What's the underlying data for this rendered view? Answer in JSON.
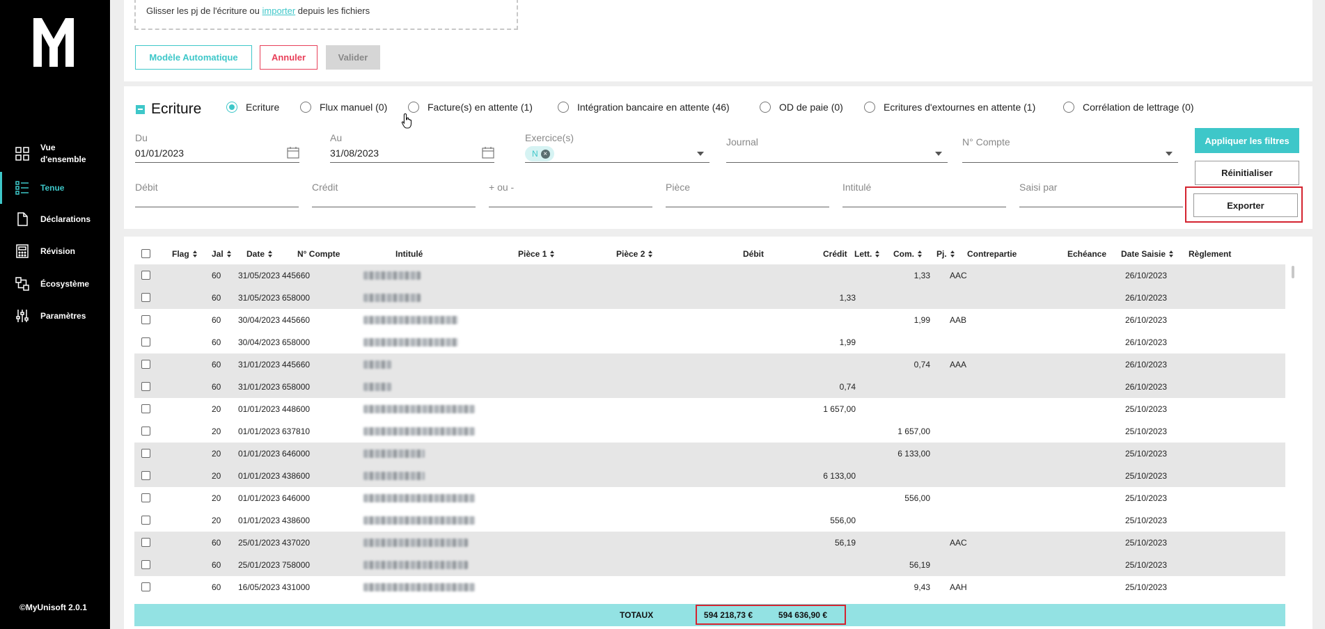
{
  "sidebar": {
    "items": [
      {
        "label": "Vue d'ensemble",
        "icon": "grid-icon"
      },
      {
        "label": "Tenue",
        "icon": "list-icon",
        "active": true
      },
      {
        "label": "Déclarations",
        "icon": "document-icon"
      },
      {
        "label": "Révision",
        "icon": "calculator-icon"
      },
      {
        "label": "Écosystème",
        "icon": "ecosystem-icon"
      },
      {
        "label": "Paramètres",
        "icon": "sliders-icon"
      }
    ],
    "version": "©MyUnisoft 2.0.1"
  },
  "upload": {
    "text_before": "Glisser les pj de l'écriture ou ",
    "link": "importer",
    "text_after": " depuis les fichiers"
  },
  "actions": {
    "modele": "Modèle Automatique",
    "annuler": "Annuler",
    "valider": "Valider"
  },
  "filters": {
    "title": "Ecriture",
    "radios": [
      {
        "label": "Ecriture",
        "checked": true
      },
      {
        "label": "Flux manuel (0)"
      },
      {
        "label": "Facture(s) en attente (1)"
      },
      {
        "label": "Intégration bancaire en attente (46)"
      },
      {
        "label": "OD de paie (0)"
      },
      {
        "label": "Ecritures d'extournes en attente (1)"
      },
      {
        "label": "Corrélation de lettrage (0)"
      }
    ],
    "du_label": "Du",
    "du_value": "01/01/2023",
    "au_label": "Au",
    "au_value": "31/08/2023",
    "exercice_label": "Exercice(s)",
    "exercice_chip": "N",
    "journal_label": "Journal",
    "compte_label": "N° Compte",
    "debit_label": "Débit",
    "credit_label": "Crédit",
    "plusmoins_label": "+ ou -",
    "piece_label": "Pièce",
    "intitule_label": "Intitulé",
    "saisi_label": "Saisi par",
    "apply": "Appliquer les filtres",
    "reset": "Réinitialiser",
    "export": "Exporter"
  },
  "table": {
    "headers": {
      "flag": "Flag",
      "jal": "Jal",
      "date": "Date",
      "compte": "N° Compte",
      "intitule": "Intitulé",
      "piece1": "Pièce 1",
      "piece2": "Pièce 2",
      "debit": "Débit",
      "credit": "Crédit",
      "lett": "Lett.",
      "com": "Com.",
      "pj": "Pj.",
      "contrepartie": "Contrepartie",
      "echeance": "Echéance",
      "date_saisie": "Date Saisie",
      "reglement": "Règlement"
    },
    "rows": [
      {
        "jal": "60",
        "date": "31/05/2023",
        "compte": "445660",
        "debit": "",
        "credit": "1,33",
        "lett": "AAC",
        "date_saisie": "26/10/2023"
      },
      {
        "jal": "60",
        "date": "31/05/2023",
        "compte": "658000",
        "debit": "1,33",
        "credit": "",
        "lett": "",
        "date_saisie": "26/10/2023"
      },
      {
        "jal": "60",
        "date": "30/04/2023",
        "compte": "445660",
        "debit": "",
        "credit": "1,99",
        "lett": "AAB",
        "date_saisie": "26/10/2023"
      },
      {
        "jal": "60",
        "date": "30/04/2023",
        "compte": "658000",
        "debit": "1,99",
        "credit": "",
        "lett": "",
        "date_saisie": "26/10/2023"
      },
      {
        "jal": "60",
        "date": "31/01/2023",
        "compte": "445660",
        "debit": "",
        "credit": "0,74",
        "lett": "AAA",
        "date_saisie": "26/10/2023"
      },
      {
        "jal": "60",
        "date": "31/01/2023",
        "compte": "658000",
        "debit": "0,74",
        "credit": "",
        "lett": "",
        "date_saisie": "26/10/2023"
      },
      {
        "jal": "20",
        "date": "01/01/2023",
        "compte": "448600",
        "debit": "1 657,00",
        "credit": "",
        "lett": "",
        "date_saisie": "25/10/2023"
      },
      {
        "jal": "20",
        "date": "01/01/2023",
        "compte": "637810",
        "debit": "",
        "credit": "1 657,00",
        "lett": "",
        "date_saisie": "25/10/2023"
      },
      {
        "jal": "20",
        "date": "01/01/2023",
        "compte": "646000",
        "debit": "",
        "credit": "6 133,00",
        "lett": "",
        "date_saisie": "25/10/2023"
      },
      {
        "jal": "20",
        "date": "01/01/2023",
        "compte": "438600",
        "debit": "6 133,00",
        "credit": "",
        "lett": "",
        "date_saisie": "25/10/2023"
      },
      {
        "jal": "20",
        "date": "01/01/2023",
        "compte": "646000",
        "debit": "",
        "credit": "556,00",
        "lett": "",
        "date_saisie": "25/10/2023"
      },
      {
        "jal": "20",
        "date": "01/01/2023",
        "compte": "438600",
        "debit": "556,00",
        "credit": "",
        "lett": "",
        "date_saisie": "25/10/2023"
      },
      {
        "jal": "60",
        "date": "25/01/2023",
        "compte": "437020",
        "debit": "56,19",
        "credit": "",
        "lett": "AAC",
        "date_saisie": "25/10/2023"
      },
      {
        "jal": "60",
        "date": "25/01/2023",
        "compte": "758000",
        "debit": "",
        "credit": "56,19",
        "lett": "",
        "date_saisie": "25/10/2023"
      },
      {
        "jal": "60",
        "date": "16/05/2023",
        "compte": "431000",
        "debit": "",
        "credit": "9,43",
        "lett": "AAH",
        "date_saisie": "25/10/2023"
      }
    ],
    "totals": {
      "label": "TOTAUX",
      "debit": "594 218,73 €",
      "credit": "594 636,90 €"
    }
  },
  "colors": {
    "accent": "#3ec7c9",
    "danger": "#e8405a",
    "highlight": "#d4232f",
    "totals_bg": "#93e2e3"
  }
}
